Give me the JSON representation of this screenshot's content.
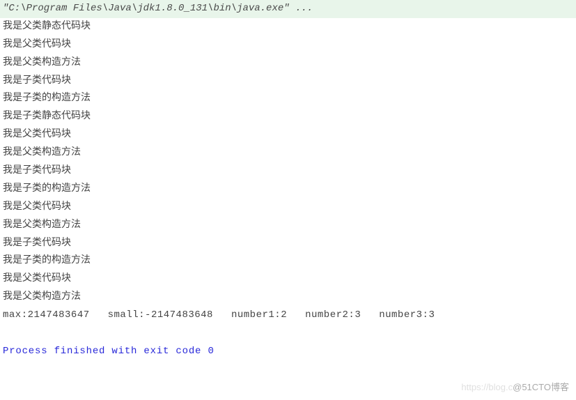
{
  "command": "\"C:\\Program Files\\Java\\jdk1.8.0_131\\bin\\java.exe\" ...",
  "output_lines": [
    "我是父类静态代码块",
    "我是父类代码块",
    "我是父类构造方法",
    "我是子类代码块",
    "我是子类的构造方法",
    "我是子类静态代码块",
    "我是父类代码块",
    "我是父类构造方法",
    "我是子类代码块",
    "我是子类的构造方法",
    "我是父类代码块",
    "我是父类构造方法",
    "我是子类代码块",
    "我是子类的构造方法",
    "我是父类代码块",
    "我是父类构造方法"
  ],
  "values": {
    "max_label": "max:",
    "max_value": "2147483647",
    "small_label": "small:",
    "small_value": "-2147483648",
    "number1_label": "number1:",
    "number1_value": "2",
    "number2_label": "number2:",
    "number2_value": "3",
    "number3_label": "number3:",
    "number3_value": "3"
  },
  "exit_message": "Process finished with exit code 0",
  "watermark": {
    "fade": "https://blog.c",
    "main": "@51CTO博客"
  }
}
